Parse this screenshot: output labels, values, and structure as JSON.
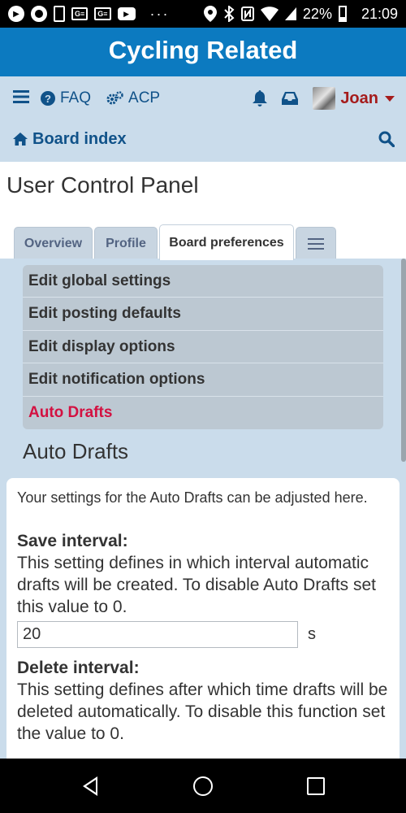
{
  "status_bar": {
    "battery_percent": "22%",
    "time": "21:09",
    "overflow_dots": "···",
    "notification_icons": [
      "play-icon",
      "record-icon",
      "phone-icon",
      "ge-icon",
      "ge-icon",
      "youtube-icon"
    ],
    "system_icons": [
      "location-icon",
      "bluetooth-icon",
      "nfc-icon",
      "wifi-icon",
      "signal-icon",
      "battery-icon"
    ]
  },
  "site": {
    "title": "Cycling Related"
  },
  "nav": {
    "faq_label": "FAQ",
    "acp_label": "ACP",
    "user_name": "Joan",
    "board_index_label": "Board index"
  },
  "page": {
    "title": "User Control Panel"
  },
  "tabs": [
    {
      "label": "Overview",
      "active": false
    },
    {
      "label": "Profile",
      "active": false
    },
    {
      "label": "Board preferences",
      "active": true
    },
    {
      "label": "",
      "icon": "menu-icon",
      "active": false
    }
  ],
  "menu": {
    "items": [
      {
        "label": "Edit global settings",
        "active": false
      },
      {
        "label": "Edit posting defaults",
        "active": false
      },
      {
        "label": "Edit display options",
        "active": false
      },
      {
        "label": "Edit notification options",
        "active": false
      },
      {
        "label": "Auto Drafts",
        "active": true
      }
    ]
  },
  "section": {
    "title": "Auto Drafts",
    "intro": "Your settings for the Auto Drafts can be adjusted here.",
    "save_interval": {
      "label": "Save interval:",
      "description": "This setting defines in which interval automatic drafts will be created. To disable Auto Drafts set this value to 0.",
      "value": "20",
      "unit": "s"
    },
    "delete_interval": {
      "label": "Delete interval:",
      "description": "This setting defines after which time drafts will be deleted automatically. To disable this function set the value to 0."
    }
  },
  "colors": {
    "header_blue": "#0c7ac0",
    "nav_bg": "#cadceb",
    "link_blue": "#105289",
    "user_red": "#a51c1c",
    "active_menu": "#d31141"
  }
}
